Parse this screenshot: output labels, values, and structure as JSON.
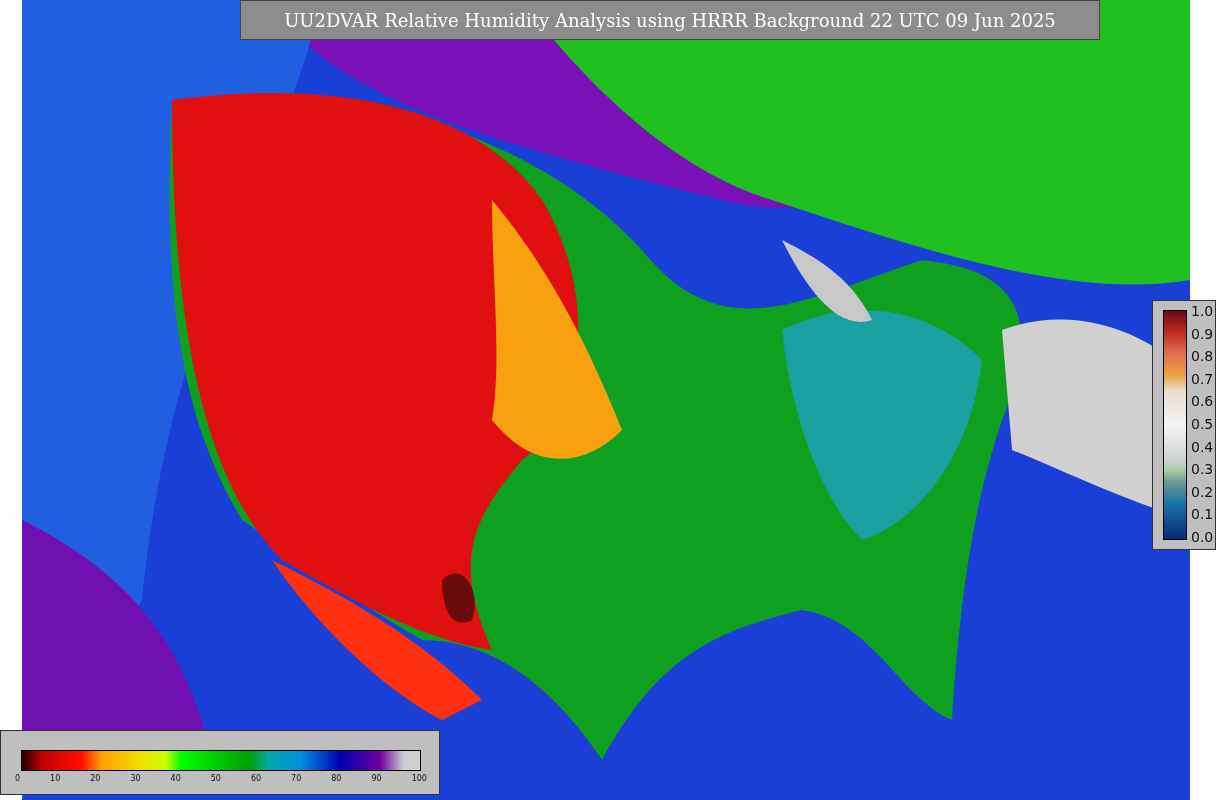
{
  "title": "UU2DVAR Relative Humidity Analysis using HRRR Background 22 UTC 09 Jun 2025",
  "side_legend": {
    "ticks": [
      "1.0",
      "0.9",
      "0.8",
      "0.7",
      "0.6",
      "0.5",
      "0.4",
      "0.3",
      "0.2",
      "0.1",
      "0.0"
    ]
  },
  "bottom_legend": {
    "ticks": [
      "0",
      "10",
      "20",
      "30",
      "40",
      "50",
      "60",
      "70",
      "80",
      "90",
      "100"
    ]
  }
}
